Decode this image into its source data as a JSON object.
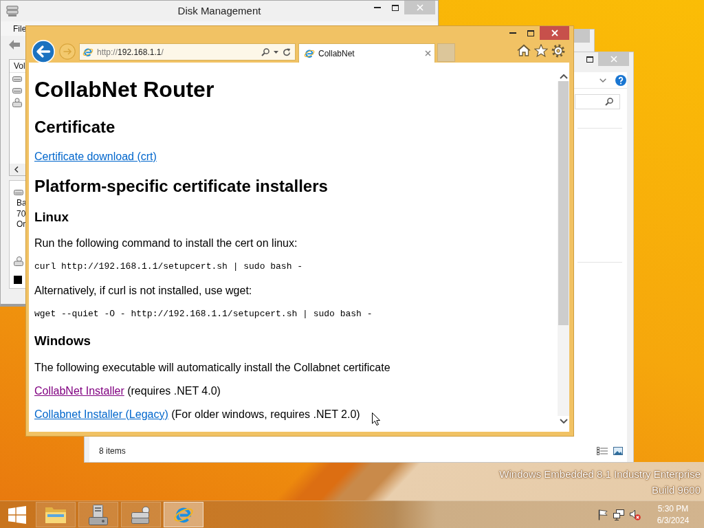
{
  "disk_management": {
    "title": "Disk Management",
    "menu": [
      "File"
    ],
    "volume_column": "Vol",
    "disk_info": [
      "Ba",
      "70",
      "Or"
    ]
  },
  "explorer": {
    "status": "8 items"
  },
  "browser": {
    "url": {
      "scheme": "http://",
      "host": "192.168.1.1",
      "path": "/"
    },
    "tabs": [
      {
        "label": "CollabNet",
        "selected": true
      }
    ],
    "page": [
      {
        "kind": "heading1",
        "text": "CollabNet Router"
      },
      {
        "kind": "heading2",
        "text": "Certificate"
      },
      {
        "kind": "link",
        "link": "Certificate download (crt)",
        "visited": false
      },
      {
        "kind": "heading2",
        "text": "Platform-specific certificate installers"
      },
      {
        "kind": "heading3",
        "text": "Linux"
      },
      {
        "kind": "paragraph",
        "text": "Run the following command to install the cert on linux:"
      },
      {
        "kind": "code",
        "text": "curl http://192.168.1.1/setupcert.sh | sudo bash -"
      },
      {
        "kind": "paragraph",
        "text": "Alternatively, if curl is not installed, use wget:"
      },
      {
        "kind": "code",
        "text": "wget --quiet -O - http://192.168.1.1/setupcert.sh | sudo bash -"
      },
      {
        "kind": "heading3",
        "text": "Windows"
      },
      {
        "kind": "paragraph",
        "text": "The following executable will automatically install the Collabnet certificate"
      },
      {
        "kind": "link",
        "link": "CollabNet Installer",
        "visited": true,
        "text": "(requires .NET 4.0)"
      },
      {
        "kind": "link",
        "link": "Collabnet Installer (Legacy)",
        "visited": false,
        "text": "(For older windows, requires .NET 2.0)"
      }
    ]
  },
  "desktop": {
    "watermark": [
      "Windows Embedded 8.1 Industry Enterprise",
      "Build 9600"
    ]
  },
  "taskbar": {
    "apps": [
      {
        "kind": "folder",
        "selected": false
      },
      {
        "kind": "tools",
        "selected": false
      },
      {
        "kind": "disk",
        "selected": false
      },
      {
        "kind": "browser",
        "selected": true
      }
    ],
    "clock": {
      "time": "5:30 PM",
      "date": "6/3/2024"
    }
  }
}
